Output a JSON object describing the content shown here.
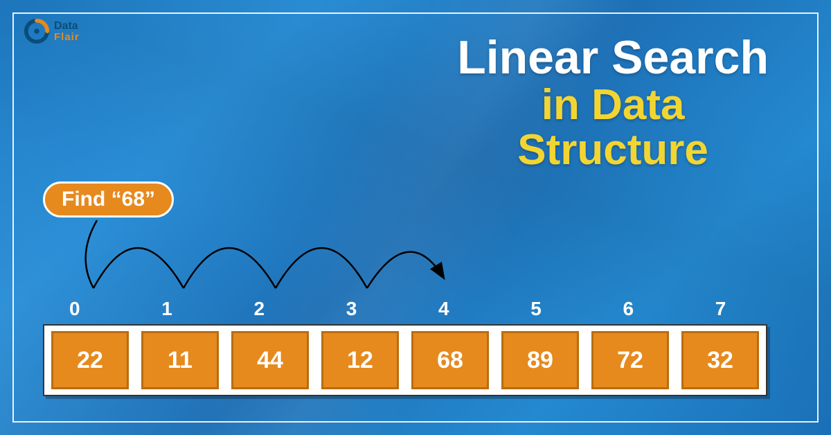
{
  "logo": {
    "line1": "Data",
    "line2": "Flair"
  },
  "title": {
    "line1": "Linear Search",
    "line2a": "in Data",
    "line2b": "Structure"
  },
  "find_label": "Find “68”",
  "indices": [
    "0",
    "1",
    "2",
    "3",
    "4",
    "5",
    "6",
    "7"
  ],
  "cells": [
    "22",
    "11",
    "44",
    "12",
    "68",
    "89",
    "72",
    "32"
  ],
  "chart_data": {
    "type": "table",
    "title": "Linear Search in Data Structure",
    "target": 68,
    "target_found_at_index": 4,
    "array_indices": [
      0,
      1,
      2,
      3,
      4,
      5,
      6,
      7
    ],
    "array_values": [
      22,
      11,
      44,
      12,
      68,
      89,
      72,
      32
    ],
    "traversal_steps_shown": [
      0,
      1,
      2,
      3,
      4
    ]
  }
}
